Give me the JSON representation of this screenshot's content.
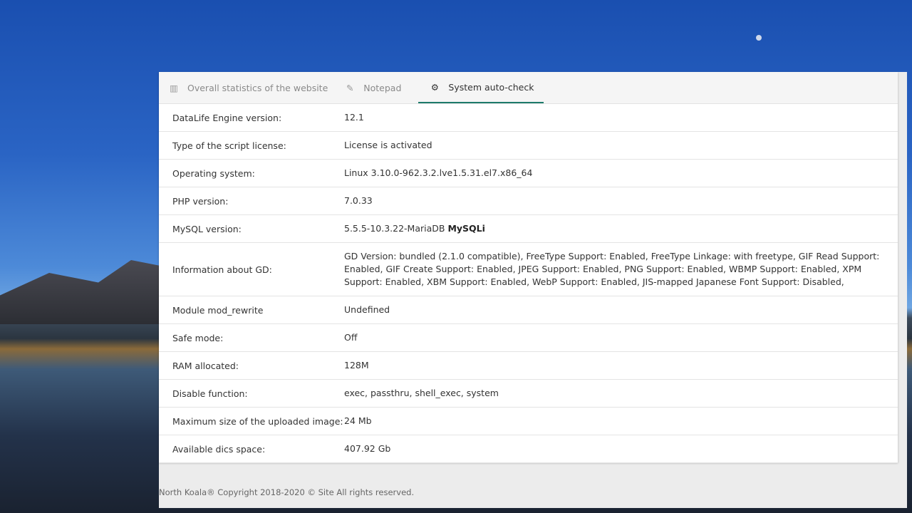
{
  "tabs": [
    {
      "label": "Overall statistics of the website",
      "icon": "bar-chart-icon"
    },
    {
      "label": "Notepad",
      "icon": "edit-icon"
    },
    {
      "label": "System auto-check",
      "icon": "gear-icon",
      "active": true
    }
  ],
  "rows": [
    {
      "label": "DataLife Engine version:",
      "value": "12.1"
    },
    {
      "label": "Type of the script license:",
      "value": "License is activated"
    },
    {
      "label": "Operating system:",
      "value": "Linux 3.10.0-962.3.2.lve1.5.31.el7.x86_64"
    },
    {
      "label": "PHP version:",
      "value": "7.0.33"
    },
    {
      "label": "MySQL version:",
      "value": "5.5.5-10.3.22-MariaDB",
      "value_bold": "MySQLi"
    },
    {
      "label": "Information about GD:",
      "value": "GD Version: bundled (2.1.0 compatible), FreeType Support: Enabled, FreeType Linkage: with freetype, GIF Read Support: Enabled, GIF Create Support: Enabled, JPEG Support: Enabled, PNG Support: Enabled, WBMP Support: Enabled, XPM Support: Enabled, XBM Support: Enabled, WebP Support: Enabled, JIS-mapped Japanese Font Support: Disabled,"
    },
    {
      "label": "Module mod_rewrite",
      "value": "Undefined"
    },
    {
      "label": "Safe mode:",
      "value": "Off"
    },
    {
      "label": "RAM allocated:",
      "value": "128M"
    },
    {
      "label": "Disable function:",
      "value": "exec, passthru, shell_exec, system"
    },
    {
      "label": "Maximum size of the uploaded image:",
      "value": "24 Mb"
    },
    {
      "label": "Available dics space:",
      "value": "407.92 Gb"
    }
  ],
  "footer": "North Koala® Copyright 2018-2020 © Site All rights reserved.",
  "colors": {
    "accent": "#1d7a6a"
  }
}
